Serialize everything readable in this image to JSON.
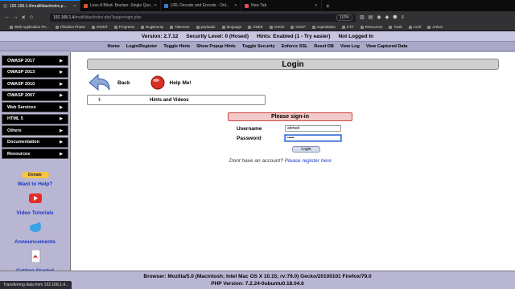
{
  "browser": {
    "tabs": [
      {
        "title": "192.168.1.4/mutillidae/index.p...",
        "active": true,
        "color": "#5b5b66"
      },
      {
        "title": "Less-8 Blind- Boolian- Single Quo...",
        "active": false,
        "color": "#d25c2c"
      },
      {
        "title": "URL Decode and Encode - Onl...",
        "active": false,
        "color": "#3a7bd5"
      },
      {
        "title": "New Tab",
        "active": false,
        "color": "#e04a5d"
      }
    ],
    "url_host": "192.168.1.4",
    "url_path": "/mutillidae/index.php?page=login.php",
    "zoom": "110%",
    "bookmarks": [
      "Web Application Pe...",
      "Filtration Phase",
      "OSINT",
      "Programs",
      "BugBounty",
      "Takeover",
      "payloads",
      "language",
      "OSEE",
      "OSCE",
      "OSCP",
      "exploitation",
      "CTF",
      "Resources",
      "Tools",
      "Conf",
      "Artical"
    ],
    "status_text": "Transferring data from 192.168.1.4..."
  },
  "header": {
    "version": "Version: 2.7.12",
    "security": "Security Level: 0 (Hosed)",
    "hints": "Hints: Enabled (1 - Try easier)",
    "login_state": "Not Logged In"
  },
  "topnav": [
    "Home",
    "Login/Register",
    "Toggle Hints",
    "Show Popup Hints",
    "Toggle Security",
    "Enforce SSL",
    "Reset DB",
    "View Log",
    "View Captured Data"
  ],
  "sidebar": {
    "items": [
      "OWASP 2017",
      "OWASP 2013",
      "OWASP 2010",
      "OWASP 2007",
      "Web Services",
      "HTML 5",
      "Others",
      "Documentation",
      "Resources"
    ],
    "donate_label": "Donate",
    "want_help": "Want to Help?",
    "video_tutorials": "Video Tutorials",
    "announcements": "Announcements",
    "getting_started": "Getting Started"
  },
  "content": {
    "title": "Login",
    "back": "Back",
    "help": "Help Me!",
    "hints_videos": "Hints and Videos",
    "signin_header": "Please sign-in",
    "username_label": "Username",
    "username_value": "ahmed",
    "password_label": "Password",
    "password_value": "•••••",
    "login_button": "Login",
    "register_prefix": "Dont have an account?",
    "register_link": "Please register here"
  },
  "footer": {
    "browser_line": "Browser: Mozilla/5.0 (Macintosh; Intel Mac OS X 10.15; rv:79.0) Gecko/20100101 Firefox/79.0",
    "php_line": "PHP Version: 7.2.24-0ubuntu0.18.04.6"
  }
}
